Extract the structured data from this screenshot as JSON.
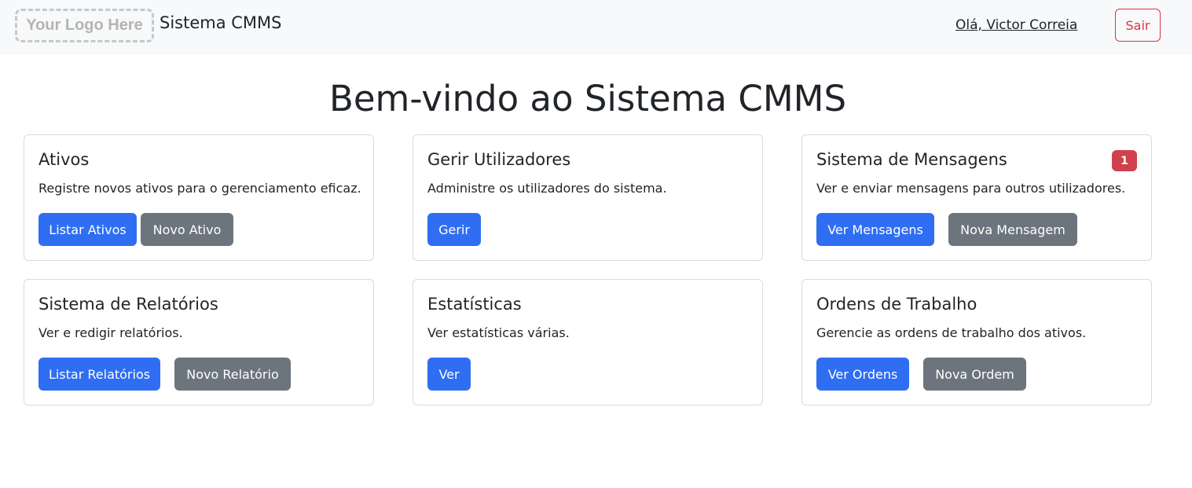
{
  "navbar": {
    "logo_text": "Your Logo Here",
    "brand": "Sistema CMMS",
    "user_greeting": "Olá, Victor Correia",
    "logout_label": "Sair"
  },
  "main": {
    "title": "Bem-vindo ao Sistema CMMS"
  },
  "cards": [
    {
      "title": "Ativos",
      "text": "Registre novos ativos para o gerenciamento eficaz.",
      "buttons": [
        "Listar Ativos",
        "Novo Ativo"
      ]
    },
    {
      "title": "Gerir Utilizadores",
      "text": "Administre os utilizadores do sistema.",
      "buttons": [
        "Gerir"
      ]
    },
    {
      "title": "Sistema de Mensagens",
      "text": "Ver e enviar mensagens para outros utilizadores.",
      "badge": "1",
      "buttons": [
        "Ver Mensagens",
        "Nova Mensagem"
      ]
    },
    {
      "title": "Sistema de Relatórios",
      "text": "Ver e redigir relatórios.",
      "buttons": [
        "Listar Relatórios",
        "Novo Relatório"
      ]
    },
    {
      "title": "Estatísticas",
      "text": "Ver estatísticas várias.",
      "buttons": [
        "Ver"
      ]
    },
    {
      "title": "Ordens de Trabalho",
      "text": "Gerencie as ordens de trabalho dos ativos.",
      "buttons": [
        "Ver Ordens",
        "Nova Ordem"
      ]
    }
  ],
  "colors": {
    "primary": "#2f6ef2",
    "secondary": "#6c757d",
    "danger": "#dc3545",
    "navbar_bg": "#f8f9fa"
  }
}
